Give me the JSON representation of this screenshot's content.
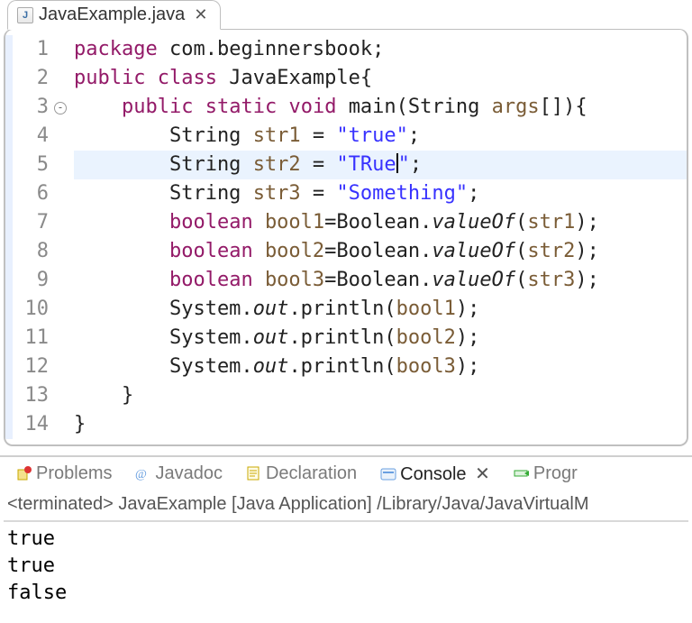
{
  "tab": {
    "filename": "JavaExample.java"
  },
  "code": {
    "lines": [
      {
        "n": 1,
        "tokens": [
          [
            "kw",
            "package"
          ],
          [
            "",
            null
          ],
          [
            "",
            "com.beginnersbook;"
          ]
        ]
      },
      {
        "n": 2,
        "tokens": [
          [
            "kw",
            "public"
          ],
          [
            "",
            null
          ],
          [
            "kw",
            "class"
          ],
          [
            "",
            null
          ],
          [
            "",
            "JavaExample{"
          ]
        ]
      },
      {
        "n": 3,
        "fold": true,
        "tokens": [
          [
            "",
            "    "
          ],
          [
            "kw",
            "public"
          ],
          [
            "",
            null
          ],
          [
            "kw",
            "static"
          ],
          [
            "",
            null
          ],
          [
            "kw",
            "void"
          ],
          [
            "",
            null
          ],
          [
            "",
            "main(String "
          ],
          [
            "var",
            "args"
          ],
          [
            "",
            "[]){"
          ]
        ]
      },
      {
        "n": 4,
        "tokens": [
          [
            "",
            "        String "
          ],
          [
            "var",
            "str1"
          ],
          [
            "",
            " = "
          ],
          [
            "str",
            "\"true\""
          ],
          [
            "",
            ";"
          ]
        ]
      },
      {
        "n": 5,
        "hl": true,
        "caret_after": "\"TRue",
        "tokens": [
          [
            "",
            "        String "
          ],
          [
            "var",
            "str2"
          ],
          [
            "",
            " = "
          ],
          [
            "str",
            "\"TRue"
          ],
          [
            "caret",
            ""
          ],
          [
            "str",
            "\""
          ],
          [
            "",
            ";"
          ]
        ]
      },
      {
        "n": 6,
        "tokens": [
          [
            "",
            "        String "
          ],
          [
            "var",
            "str3"
          ],
          [
            "",
            " = "
          ],
          [
            "str",
            "\"Something\""
          ],
          [
            "",
            ";"
          ]
        ]
      },
      {
        "n": 7,
        "tokens": [
          [
            "",
            "        "
          ],
          [
            "kw",
            "boolean"
          ],
          [
            "",
            null
          ],
          [
            "var",
            "bool1"
          ],
          [
            "",
            "=Boolean."
          ],
          [
            "met-i",
            "valueOf"
          ],
          [
            "",
            "("
          ],
          [
            "var",
            "str1"
          ],
          [
            "",
            ");"
          ]
        ]
      },
      {
        "n": 8,
        "tokens": [
          [
            "",
            "        "
          ],
          [
            "kw",
            "boolean"
          ],
          [
            "",
            null
          ],
          [
            "var",
            "bool2"
          ],
          [
            "",
            "=Boolean."
          ],
          [
            "met-i",
            "valueOf"
          ],
          [
            "",
            "("
          ],
          [
            "var",
            "str2"
          ],
          [
            "",
            ");"
          ]
        ]
      },
      {
        "n": 9,
        "tokens": [
          [
            "",
            "        "
          ],
          [
            "kw",
            "boolean"
          ],
          [
            "",
            null
          ],
          [
            "var",
            "bool3"
          ],
          [
            "",
            "=Boolean."
          ],
          [
            "met-i",
            "valueOf"
          ],
          [
            "",
            "("
          ],
          [
            "var",
            "str3"
          ],
          [
            "",
            ");"
          ]
        ]
      },
      {
        "n": 10,
        "tokens": [
          [
            "",
            "        System."
          ],
          [
            "met-i",
            "out"
          ],
          [
            "",
            ".println("
          ],
          [
            "var",
            "bool1"
          ],
          [
            "",
            ");"
          ]
        ]
      },
      {
        "n": 11,
        "tokens": [
          [
            "",
            "        System."
          ],
          [
            "met-i",
            "out"
          ],
          [
            "",
            ".println("
          ],
          [
            "var",
            "bool2"
          ],
          [
            "",
            ");"
          ]
        ]
      },
      {
        "n": 12,
        "tokens": [
          [
            "",
            "        System."
          ],
          [
            "met-i",
            "out"
          ],
          [
            "",
            ".println("
          ],
          [
            "var",
            "bool3"
          ],
          [
            "",
            ");"
          ]
        ]
      },
      {
        "n": 13,
        "tokens": [
          [
            "",
            "    }"
          ]
        ]
      },
      {
        "n": 14,
        "tokens": [
          [
            "",
            "}"
          ]
        ]
      }
    ]
  },
  "bottom_tabs": {
    "items": [
      {
        "label": "Problems",
        "icon": "problems"
      },
      {
        "label": "Javadoc",
        "icon": "javadoc"
      },
      {
        "label": "Declaration",
        "icon": "declaration"
      },
      {
        "label": "Console",
        "icon": "console",
        "selected": true
      },
      {
        "label": "Progr",
        "icon": "progress"
      }
    ]
  },
  "console": {
    "header": "<terminated> JavaExample [Java Application] /Library/Java/JavaVirtualM",
    "output": [
      "true",
      "true",
      "false"
    ]
  }
}
